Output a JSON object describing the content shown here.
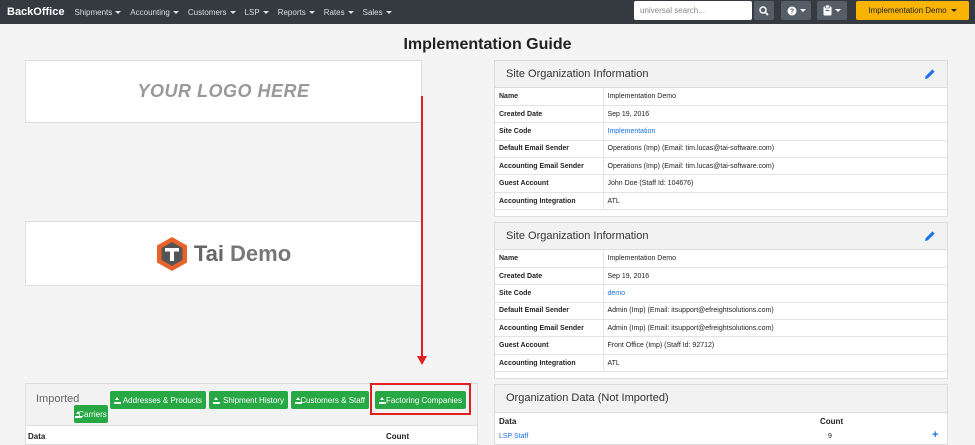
{
  "navbar": {
    "brand": "BackOffice",
    "menus": [
      "Shipments",
      "Accounting",
      "Customers",
      "LSP",
      "Reports",
      "Rates",
      "Sales"
    ],
    "search_placeholder": "universal search...",
    "impl_label": "Implementation Demo"
  },
  "page_title": "Implementation Guide",
  "logo_placeholder": "YOUR LOGO HERE",
  "tai_logo": {
    "tai": "Tai",
    "demo": "Demo"
  },
  "site_info_1": {
    "title": "Site Organization Information",
    "rows": [
      {
        "k": "Name",
        "v": "Implementation Demo"
      },
      {
        "k": "Created Date",
        "v": "Sep 19, 2016"
      },
      {
        "k": "Site Code",
        "v": "Implementation"
      },
      {
        "k": "Default Email Sender",
        "v": "Operations (Imp) (Email: tim.lucas@tai-software.com)"
      },
      {
        "k": "Accounting Email Sender",
        "v": "Operations (Imp) (Email: tim.lucas@tai-software.com)"
      },
      {
        "k": "Guest Account",
        "v": "John Doe (Staff Id: 104676)"
      },
      {
        "k": "Accounting Integration",
        "v": "ATL"
      }
    ]
  },
  "site_info_2": {
    "title": "Site Organization Information",
    "rows": [
      {
        "k": "Name",
        "v": "Implementation Demo"
      },
      {
        "k": "Created Date",
        "v": "Sep 19, 2016"
      },
      {
        "k": "Site Code",
        "v": "demo"
      },
      {
        "k": "Default Email Sender",
        "v": "Admin (Imp) (Email: itsupport@efreightsolutions.com)"
      },
      {
        "k": "Accounting Email Sender",
        "v": "Admin (Imp) (Email: itsupport@efreightsolutions.com)"
      },
      {
        "k": "Guest Account",
        "v": "Front Office (Imp) (Staff Id: 92712)"
      },
      {
        "k": "Accounting Integration",
        "v": "ATL"
      }
    ]
  },
  "imported": {
    "label": "Imported",
    "buttons": [
      "Addresses & Products",
      "Shipment History",
      "Customers & Staff",
      "Factoring Companies",
      "Carriers"
    ],
    "col_data": "Data",
    "col_count": "Count"
  },
  "org_data": {
    "title": "Organization Data (Not Imported)",
    "col_data": "Data",
    "col_count": "Count",
    "row_label": "LSP Staff",
    "row_count": "9"
  },
  "colors": {
    "accent": "#28a745",
    "highlight": "#e02020",
    "brand_button": "#f8b400"
  }
}
